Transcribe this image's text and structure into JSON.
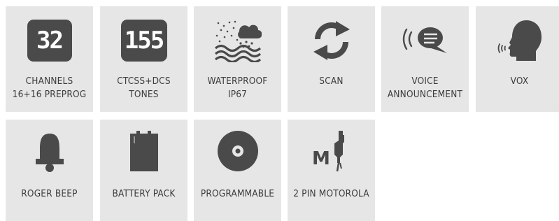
{
  "colors": {
    "tile_bg": "#e6e6e6",
    "icon": "#4a4a4a",
    "text": "#3c3c3c"
  },
  "features": [
    {
      "id": "channels",
      "icon": "number-box-icon",
      "badge": "32",
      "lines": [
        "CHANNELS",
        "16+16 PREPROG"
      ]
    },
    {
      "id": "tones",
      "icon": "number-box-icon",
      "badge": "155",
      "lines": [
        "CTCSS+DCS",
        "TONES"
      ]
    },
    {
      "id": "waterproof",
      "icon": "rain-water-icon",
      "lines": [
        "WATERPROOF",
        "IP67"
      ]
    },
    {
      "id": "scan",
      "icon": "refresh-arrows-icon",
      "lines": [
        "SCAN"
      ]
    },
    {
      "id": "voice",
      "icon": "speech-bubble-icon",
      "lines": [
        "VOICE",
        "ANNOUNCEMENT"
      ]
    },
    {
      "id": "vox",
      "icon": "speaking-head-icon",
      "lines": [
        "VOX"
      ]
    },
    {
      "id": "roger",
      "icon": "bell-icon",
      "lines": [
        "ROGER BEEP"
      ]
    },
    {
      "id": "battery",
      "icon": "battery-icon",
      "lines": [
        "BATTERY PACK"
      ]
    },
    {
      "id": "programmable",
      "icon": "disc-icon",
      "lines": [
        "PROGRAMMABLE"
      ]
    },
    {
      "id": "motorola",
      "icon": "connector-plug-icon",
      "badge": "M",
      "lines": [
        "2 PIN MOTOROLA"
      ]
    }
  ]
}
